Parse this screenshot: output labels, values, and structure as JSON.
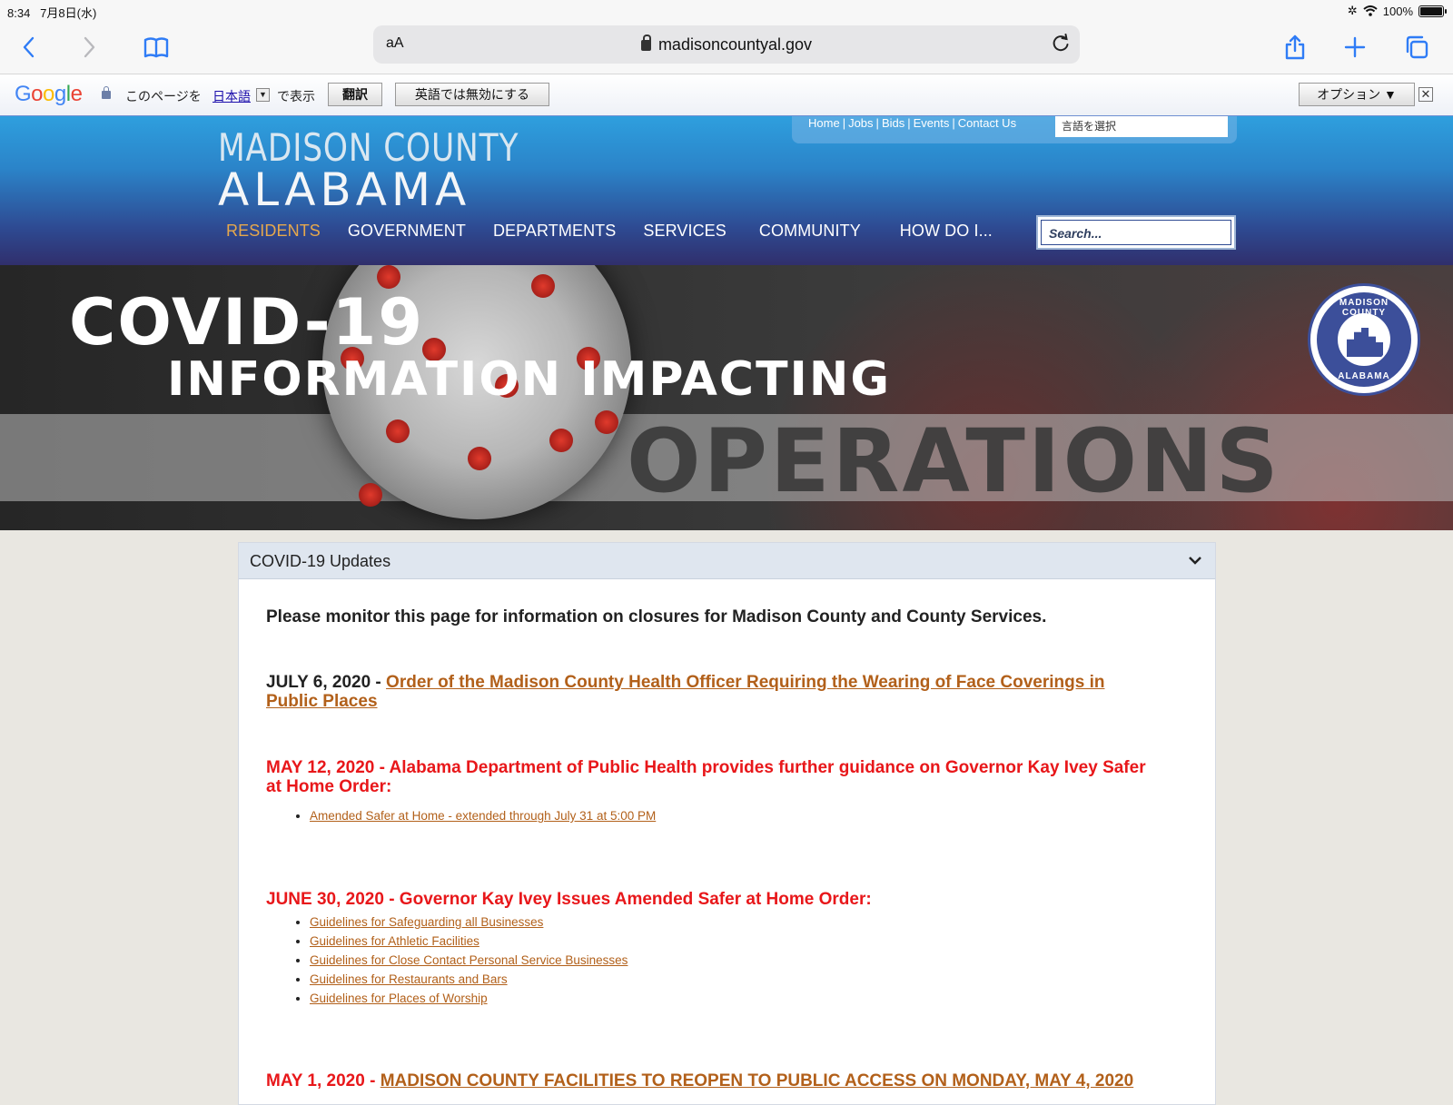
{
  "statusbar": {
    "time": "8:34",
    "date": "7月8日(水)",
    "battery": "100%"
  },
  "browser": {
    "aa_label": "aA",
    "url": "madisoncountyal.gov"
  },
  "translate_bar": {
    "logo": "Google",
    "text_before": "このページを",
    "language": "日本語",
    "text_after": "で表示",
    "translate_button": "翻訳",
    "disable_button": "英語では無効にする",
    "options_button": "オプション ▼",
    "close": "✕"
  },
  "header": {
    "logo_line1": "MADISON COUNTY",
    "logo_line2": "ALABAMA",
    "utility_links": [
      "Home",
      "Jobs",
      "Bids",
      "Events",
      "Contact Us"
    ],
    "language_select": "言語を選択",
    "nav": [
      "RESIDENTS",
      "GOVERNMENT",
      "DEPARTMENTS",
      "SERVICES",
      "COMMUNITY",
      "HOW DO I..."
    ],
    "search_placeholder": "Search..."
  },
  "banner": {
    "line1": "COVID-19",
    "line2": "INFORMATION IMPACTING",
    "line3": "OPERATIONS",
    "seal_top": "MADISON COUNTY",
    "seal_bottom": "ALABAMA"
  },
  "panel": {
    "title": "COVID-19 Updates",
    "intro": "Please monitor this page for information on closures for Madison County and County Services.",
    "entry1": {
      "date": "JULY 6, 2020 - ",
      "link": "Order of the Madison County Health Officer Requiring the Wearing of Face Coverings in Public Places"
    },
    "entry2": {
      "text": "MAY 12, 2020 - Alabama Department of Public Health provides further guidance on Governor Kay Ivey Safer at Home Order:",
      "items": [
        "Amended Safer at Home - extended through July 31 at 5:00 PM"
      ]
    },
    "entry3": {
      "text": "JUNE 30, 2020 - Governor Kay Ivey Issues Amended Safer at Home Order:",
      "items": [
        "Guidelines for Safeguarding all Businesses",
        "Guidelines for Athletic Facilities",
        "Guidelines for Close Contact Personal Service Businesses",
        "Guidelines for Restaurants and Bars",
        "Guidelines for Places of Worship"
      ]
    },
    "entry4": {
      "date": "MAY 1, 2020 - ",
      "link": "MADISON COUNTY FACILITIES TO REOPEN TO PUBLIC ACCESS ON MONDAY, MAY 4, 2020"
    }
  }
}
